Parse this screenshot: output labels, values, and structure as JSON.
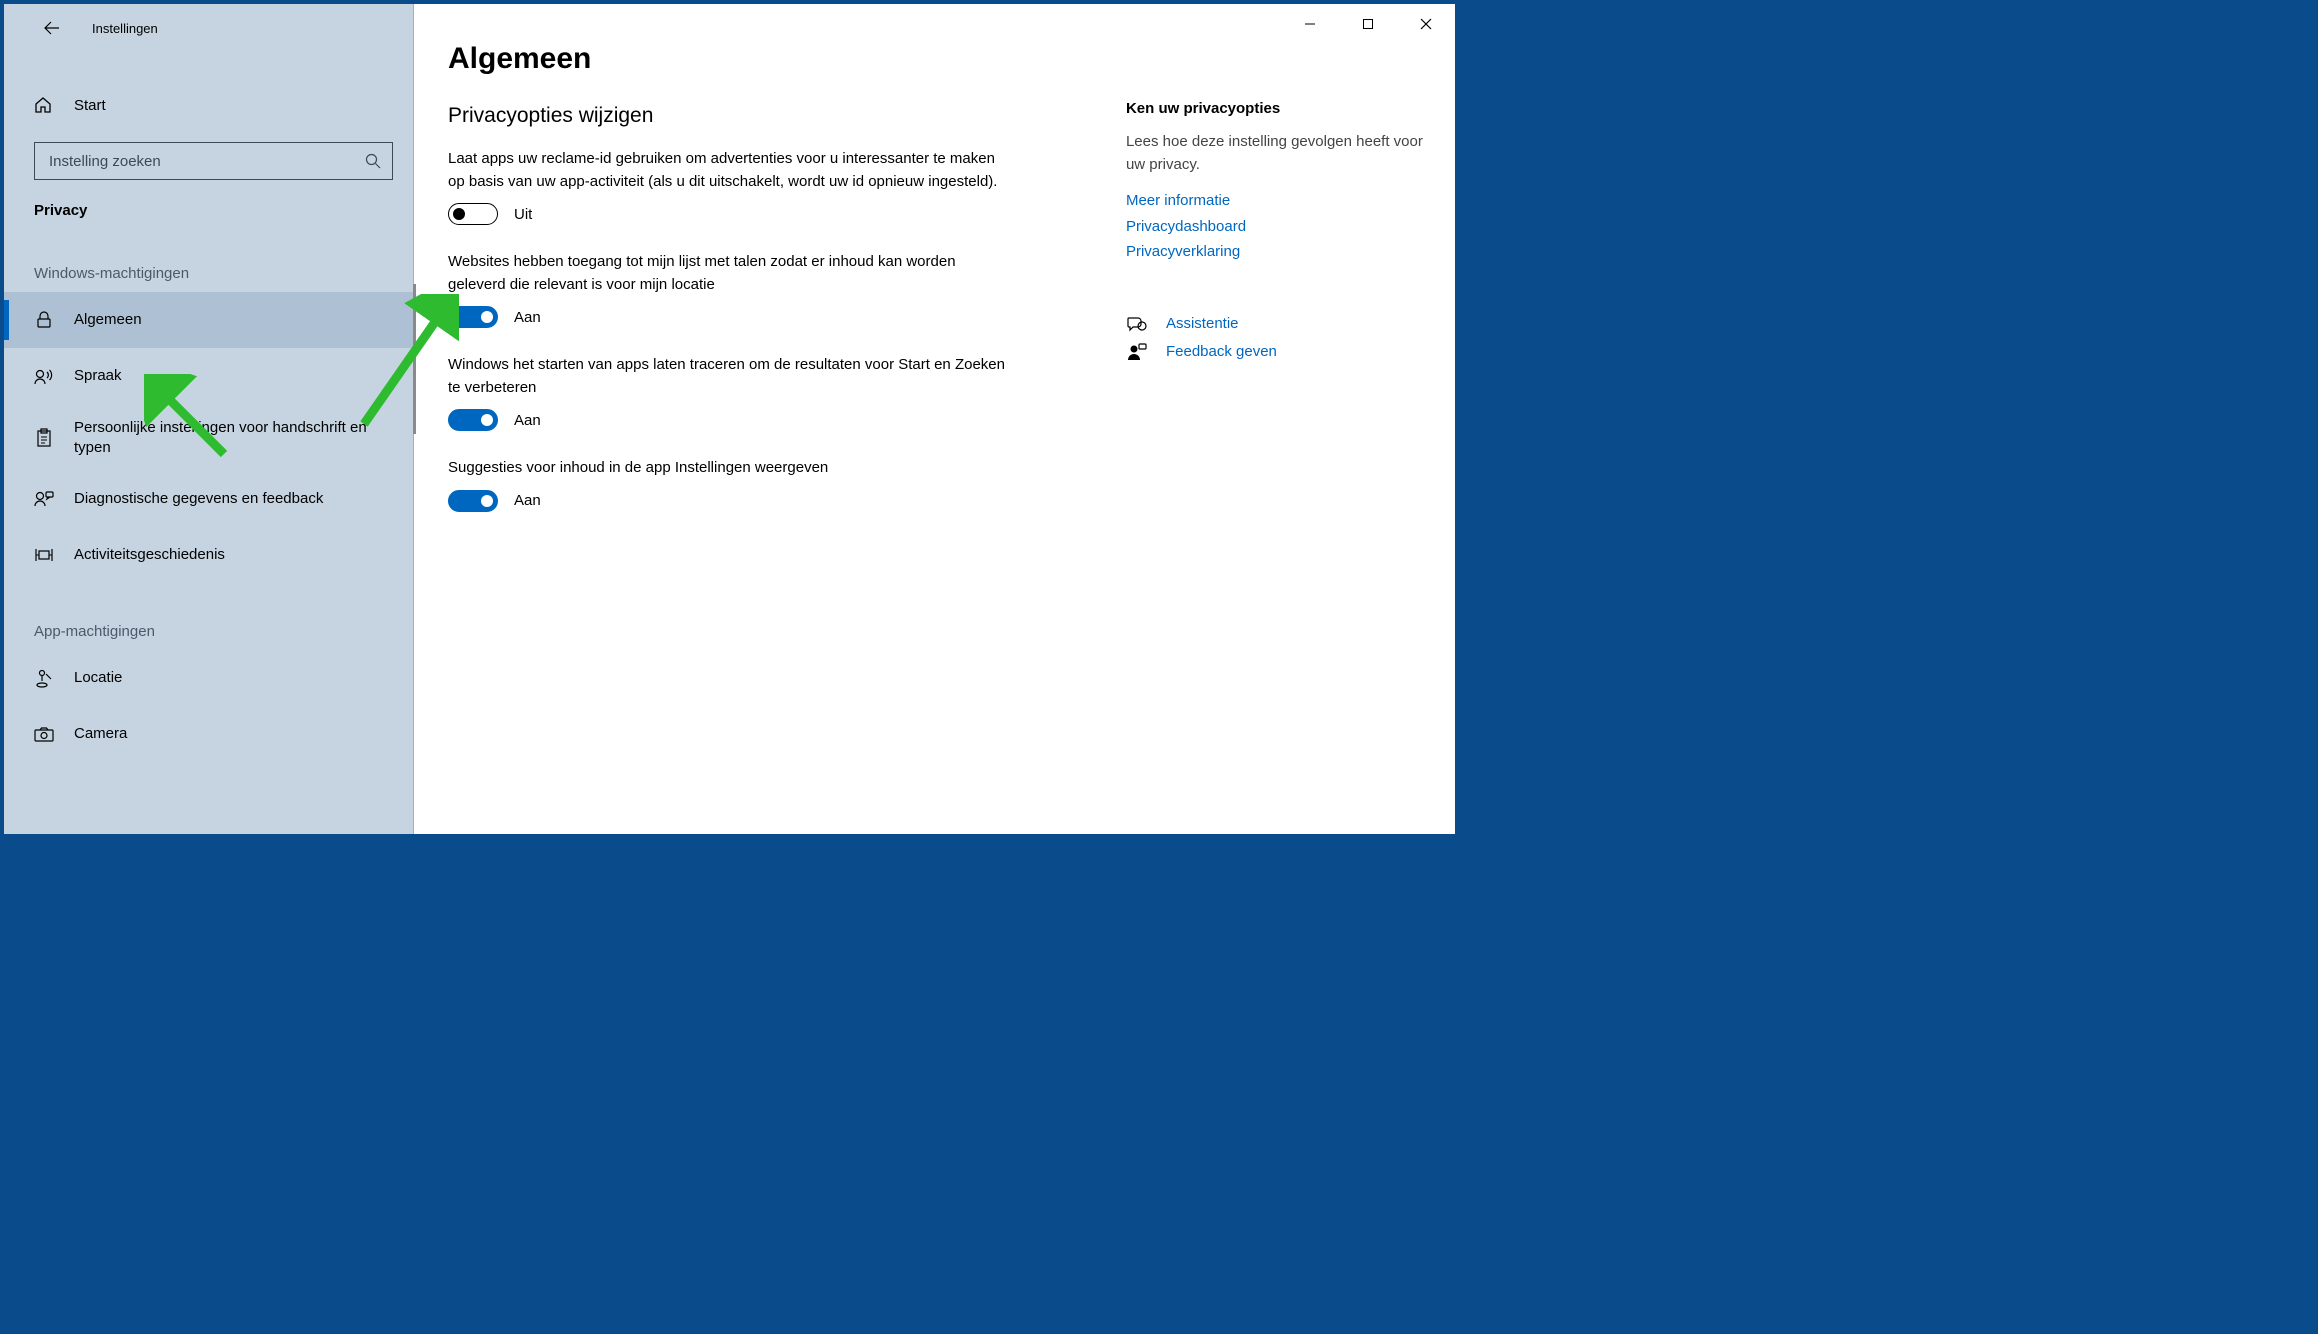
{
  "window": {
    "title": "Instellingen",
    "controls": {
      "minimize": "min",
      "maximize": "max",
      "close": "close"
    }
  },
  "sidebar": {
    "home": "Start",
    "search_placeholder": "Instelling zoeken",
    "category": "Privacy",
    "groups": [
      {
        "title": "Windows-machtigingen",
        "items": [
          {
            "icon": "lock",
            "label": "Algemeen",
            "active": true
          },
          {
            "icon": "speech",
            "label": "Spraak"
          },
          {
            "icon": "inking",
            "label": "Persoonlijke instellingen voor handschrift en typen"
          },
          {
            "icon": "feedback",
            "label": "Diagnostische gegevens en feedback"
          },
          {
            "icon": "activity",
            "label": "Activiteitsgeschiedenis"
          }
        ]
      },
      {
        "title": "App-machtigingen",
        "items": [
          {
            "icon": "location",
            "label": "Locatie"
          },
          {
            "icon": "camera",
            "label": "Camera"
          }
        ]
      }
    ]
  },
  "main": {
    "heading": "Algemeen",
    "subheading": "Privacyopties wijzigen",
    "options": [
      {
        "desc": "Laat apps uw reclame-id gebruiken om advertenties voor u interessanter te maken op basis van uw app-activiteit (als u dit uitschakelt, wordt uw id opnieuw ingesteld).",
        "state": "off",
        "state_label": "Uit"
      },
      {
        "desc": "Websites hebben toegang tot mijn lijst met talen zodat er inhoud kan worden geleverd die relevant is voor mijn locatie",
        "state": "on",
        "state_label": "Aan"
      },
      {
        "desc": "Windows het starten van apps laten traceren om de resultaten voor Start en Zoeken te verbeteren",
        "state": "on",
        "state_label": "Aan"
      },
      {
        "desc": "Suggesties voor inhoud in de app Instellingen weergeven",
        "state": "on",
        "state_label": "Aan"
      }
    ]
  },
  "sidepanel": {
    "title": "Ken uw privacyopties",
    "body": "Lees hoe deze instelling gevolgen heeft voor uw privacy.",
    "links": [
      "Meer informatie",
      "Privacydashboard",
      "Privacyverklaring"
    ],
    "actions": [
      {
        "icon": "help",
        "label": "Assistentie"
      },
      {
        "icon": "feedback-person",
        "label": "Feedback geven"
      }
    ]
  }
}
